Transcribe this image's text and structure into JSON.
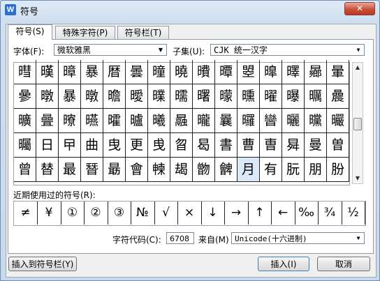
{
  "window": {
    "title": "符号",
    "app_icon_letter": "W",
    "close_label": "✕"
  },
  "tabs": [
    {
      "label": "符号(S)"
    },
    {
      "label": "特殊字符(P)"
    },
    {
      "label": "符号栏(T)"
    }
  ],
  "font": {
    "label": "字体(F):",
    "value": "微软雅黑"
  },
  "subset": {
    "label": "子集(U):",
    "value": "CJK 统一汉字"
  },
  "symbol_grid": {
    "rows": [
      [
        "暳",
        "暵",
        "暲",
        "暴",
        "暦",
        "曇",
        "曈",
        "曉",
        "曊",
        "曋",
        "曌",
        "曍",
        "曎",
        "曏",
        "暈"
      ],
      [
        "曑",
        "暾",
        "暴",
        "暾",
        "曕",
        "曖",
        "曗",
        "曘",
        "曙",
        "曚",
        "曛",
        "曜",
        "曝",
        "曞",
        "曟"
      ],
      [
        "曠",
        "曡",
        "曢",
        "曣",
        "曤",
        "曥",
        "曦",
        "曧",
        "曨",
        "曩",
        "曪",
        "曫",
        "曬",
        "曭",
        "曮"
      ],
      [
        "曯",
        "日",
        "曱",
        "曲",
        "曳",
        "更",
        "曵",
        "曶",
        "曷",
        "書",
        "曹",
        "曺",
        "曻",
        "曼",
        "曽"
      ],
      [
        "曾",
        "替",
        "最",
        "朁",
        "朂",
        "會",
        "朄",
        "朅",
        "朆",
        "朇",
        "月",
        "有",
        "朊",
        "朋",
        "朌"
      ]
    ],
    "selected": {
      "row": 4,
      "col": 10
    }
  },
  "recent": {
    "label": "近期使用过的符号(R):",
    "symbols": [
      "≠",
      "¥",
      "①",
      "②",
      "③",
      "№",
      "√",
      "×",
      "↓",
      "→",
      "↑",
      "←",
      "‰",
      "¾",
      "½"
    ]
  },
  "charcode": {
    "label": "字符代码(C):",
    "value": "6708",
    "from_label": "来自(M)",
    "from_value": "Unicode(十六进制)"
  },
  "buttons": {
    "insert_to_bar": "插入到符号栏(Y)",
    "insert": "插入(I)",
    "cancel": "取消"
  }
}
